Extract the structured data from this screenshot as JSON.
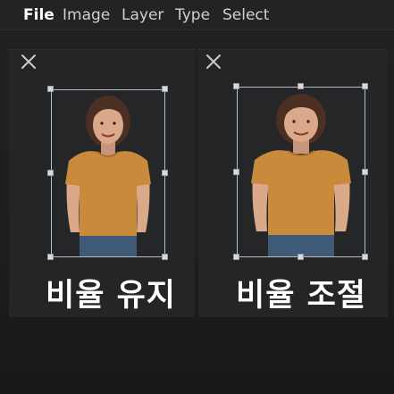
{
  "menu": {
    "file": "File",
    "image": "Image",
    "layer": "Layer",
    "type": "Type",
    "select": "Select"
  },
  "panels": {
    "left": {
      "caption": "비율 유지",
      "close_icon": "close-icon"
    },
    "right": {
      "caption": "비율 조절",
      "close_icon": "close-icon"
    }
  },
  "colors": {
    "shirt": "#c98a3c",
    "jeans": "#3e5a78",
    "skin": "#d9a98a",
    "hair": "#4a2f22",
    "handle": "#d8dadc"
  }
}
